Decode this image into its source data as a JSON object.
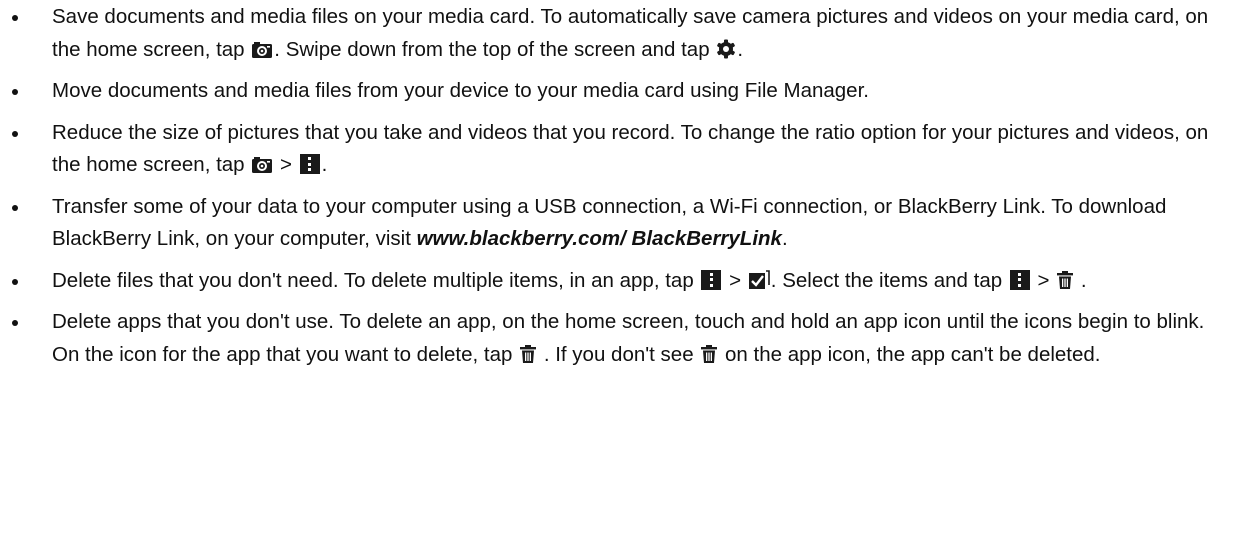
{
  "tips": [
    {
      "seg": [
        "Save documents and media files on your media card. To automatically save camera pictures and videos on your media card, on the home screen, tap ",
        ". Swipe down from the top of the screen and tap ",
        "."
      ],
      "icons": [
        "camera-icon",
        "gear-icon"
      ]
    },
    {
      "seg": [
        "Move documents and media files from your device to your media card using File Manager."
      ]
    },
    {
      "seg": [
        "Reduce the size of pictures that you take and videos that you record. To change the ratio option for your pictures and videos, on the home screen, tap ",
        " > ",
        "."
      ],
      "icons": [
        "camera-icon",
        "more-menu-icon"
      ]
    },
    {
      "seg": [
        "Transfer some of your data to your computer using a USB connection, a Wi-Fi connection, or BlackBerry Link. To download BlackBerry Link, on your computer, visit ",
        "."
      ],
      "link": "www.blackberry.com/ BlackBerryLink"
    },
    {
      "seg": [
        "Delete files that you don't need. To delete multiple items, in an app, tap ",
        " > ",
        ". Select the items and tap ",
        " > ",
        " ."
      ],
      "icons": [
        "more-menu-icon",
        "select-items-icon",
        "more-menu-icon",
        "trash-icon"
      ]
    },
    {
      "seg": [
        "Delete apps that you don't use. To delete an app, on the home screen, touch and hold an app icon until the icons begin to blink. On the icon for the app that you want to delete, tap ",
        " . If you don't see ",
        " on the app icon, the app can't be deleted."
      ],
      "icons": [
        "trash-icon",
        "trash-icon"
      ]
    }
  ]
}
